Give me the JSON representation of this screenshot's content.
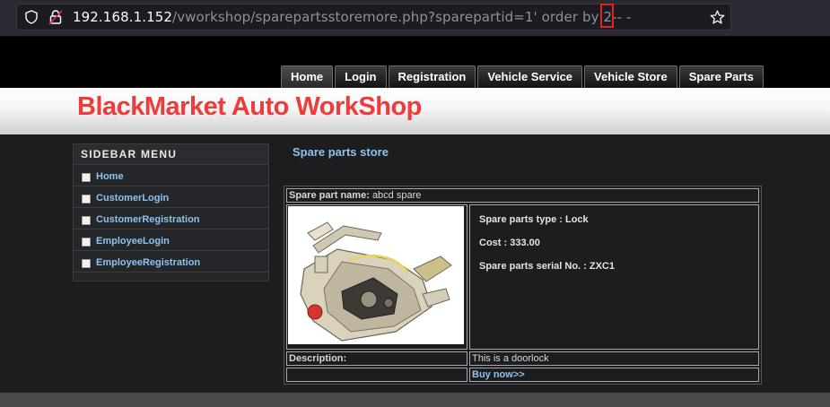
{
  "browser": {
    "url_host": "192.168.1.152",
    "url_path_before": "/vworkshop/sparepartsstoremore.php?sparepartid=1' order by ",
    "url_marked": "2",
    "url_path_after": "-- -"
  },
  "nav": {
    "items": [
      "Home",
      "Login",
      "Registration",
      "Vehicle Service",
      "Vehicle Store",
      "Spare Parts"
    ],
    "active": "Home"
  },
  "site": {
    "title": "BlackMarket Auto WorkShop"
  },
  "sidebar": {
    "heading": "SIDEBAR MENU",
    "items": [
      "Home",
      "CustomerLogin",
      "CustomerRegistration",
      "EmployeeLogin",
      "EmployeeRegistration"
    ]
  },
  "content": {
    "title": "Spare parts store",
    "part_name_label": "Spare part name:",
    "part_name": "abcd spare",
    "type_line": "Spare parts type : Lock",
    "cost_line": "Cost : 333.00",
    "serial_line": "Spare parts serial No. : ZXC1",
    "description_label": "Description:",
    "description": "This is a doorlock",
    "buy_label": "Buy now>>"
  },
  "colors": {
    "title_red": "#ee3b3b",
    "link_blue": "#8ec2ee",
    "highlight_red": "#e0241b"
  }
}
